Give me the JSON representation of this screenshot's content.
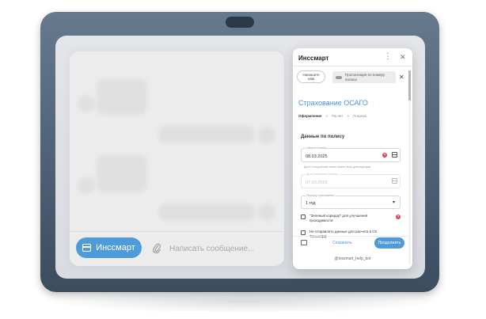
{
  "chat": {
    "bot_button_label": "Инссмарт",
    "message_placeholder": "Написать сообщение..."
  },
  "bot_panel": {
    "title": "Инссмарт",
    "write_chip": "Напишите нам",
    "extend_chip": "Пролонгация по номеру полиса",
    "heading": "Страхование ОСАГО",
    "steps": [
      "Оформление",
      "Расчет",
      "Покупка"
    ],
    "step_separator": ">",
    "section_title": "Данные по полису",
    "fields": {
      "start_date_label": "Начало полиса",
      "start_date_value": "08.03.2025",
      "start_date_hint": "Дата с которой ваш полис начнет быть действующим",
      "end_date_label": "Дата окончания полиса",
      "end_date_value": "07.03.2026",
      "period_label": "Период страхования",
      "period_value": "1 год"
    },
    "checkbox_green": "\"Зеленый коридор\" для улучшения проходимости",
    "checkbox_send": "Не отправлять данные для расчета в СК Тинькофф",
    "save_label": "Сохранить",
    "continue_label": "Продолжить",
    "bot_handle": "@inssmart_help_bot"
  },
  "colors": {
    "accent": "#4f9bd8",
    "heading": "#4a90d9",
    "tablet_frame": "#4b5d71",
    "help_icon": "#d9435f"
  }
}
